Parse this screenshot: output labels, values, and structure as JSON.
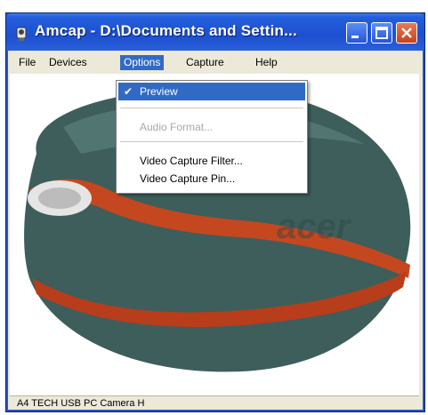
{
  "window": {
    "title": "Amcap - D:\\Documents and Settin..."
  },
  "menubar": {
    "items": [
      {
        "label": "File"
      },
      {
        "label": "Devices"
      },
      {
        "label": "Options"
      },
      {
        "label": "Capture"
      },
      {
        "label": "Help"
      }
    ]
  },
  "options_menu": {
    "preview": "Preview",
    "audio_format": "Audio Format...",
    "video_capture_filter": "Video Capture Filter...",
    "video_capture_pin": "Video Capture Pin..."
  },
  "statusbar": {
    "text": "A4 TECH USB PC Camera H"
  },
  "colors": {
    "titlebar": "#245edb",
    "menu_highlight": "#316ac5",
    "mouse_body": "#3d5e5b",
    "mouse_accent": "#c5471f"
  }
}
